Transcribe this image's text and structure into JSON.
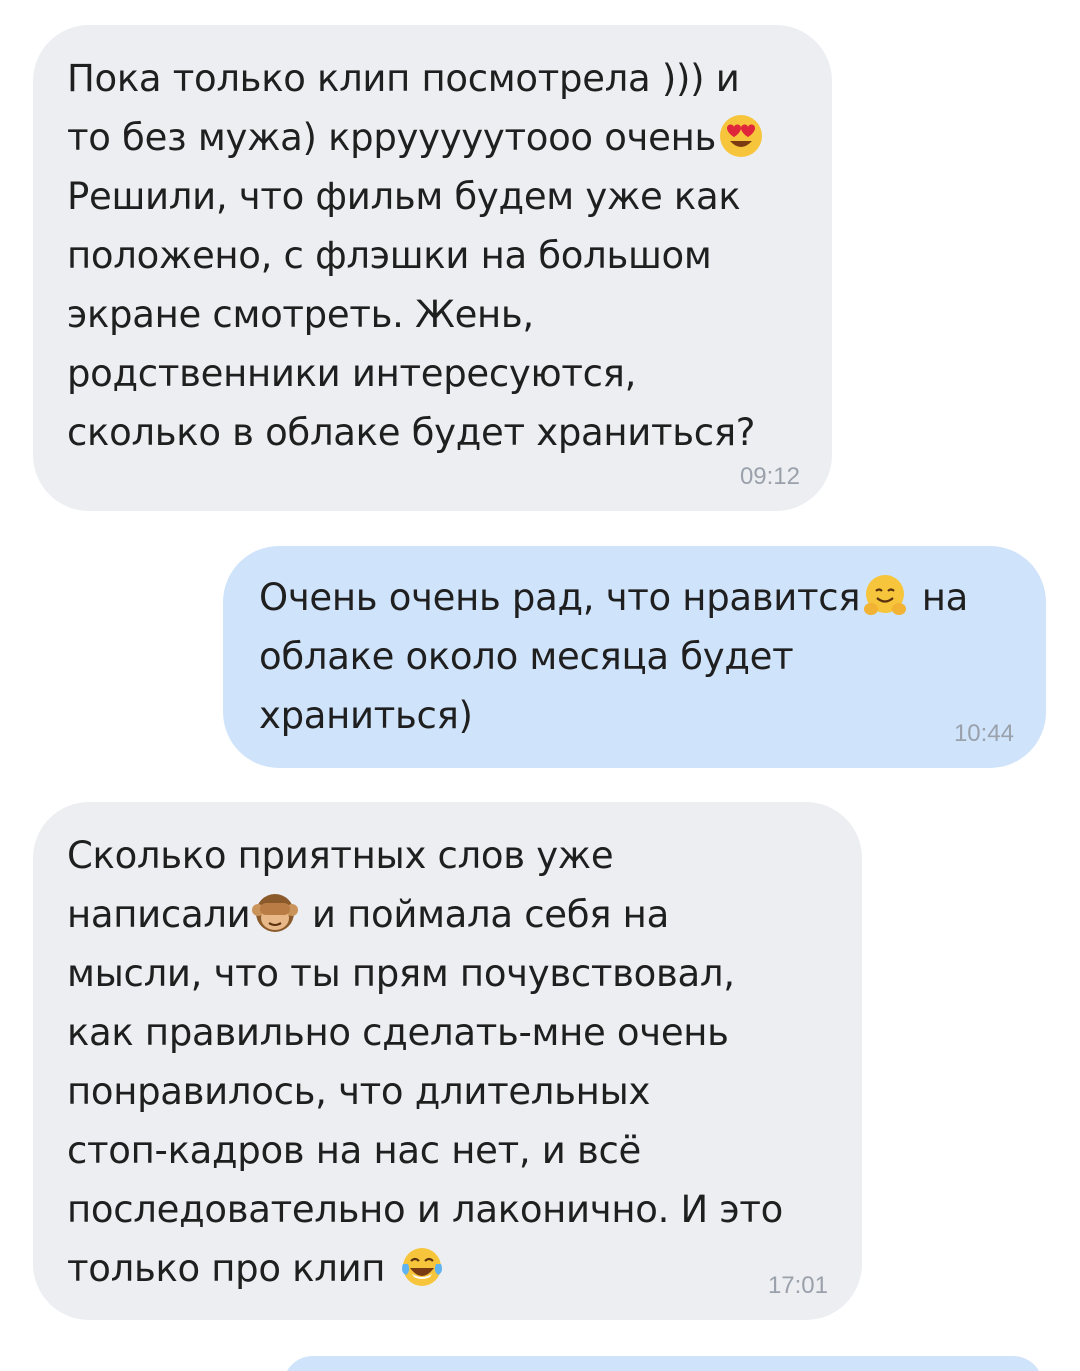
{
  "messages": [
    {
      "direction": "incoming",
      "lines": [
        "Пока только клип посмотрела ))) и",
        "то без мужа) кррууууутооо очень"
      ],
      "emoji_after_line2": "heart-eyes-emoji",
      "lines_after": [
        "Решили, что фильм будем уже как",
        "положено, с флэшки на большом",
        "экране смотреть. Жень,",
        "родственники интересуются,",
        "сколько в облаке будет храниться?"
      ],
      "time": "09:12"
    },
    {
      "direction": "outgoing",
      "line1_before_emoji": "Очень очень рад, что нравится",
      "emoji": "hugging-face-emoji",
      "line1_after_emoji": " на",
      "lines_after": [
        "облаке около месяца будет",
        "храниться)"
      ],
      "time": "10:44"
    },
    {
      "direction": "incoming",
      "line1": "Сколько приятных слов уже",
      "line2_before_emoji": "написали",
      "emoji": "see-no-evil-monkey-emoji",
      "line2_after_emoji": " и поймала себя на",
      "lines_after": [
        "мысли, что ты прям почувствовал,",
        "как правильно сделать-мне очень",
        "понравилось, что длительных",
        "стоп-кадров на нас нет, и всё",
        "последовательно и лаконично. И это"
      ],
      "last_line_before_emoji": "только про клип ",
      "last_emoji": "tears-of-joy-emoji",
      "time": "17:01"
    }
  ],
  "colors": {
    "incoming_bubble": "#eceef2",
    "outgoing_bubble": "#cfe3fb",
    "text": "#1f1f1f",
    "time": "#9aa1ab"
  }
}
